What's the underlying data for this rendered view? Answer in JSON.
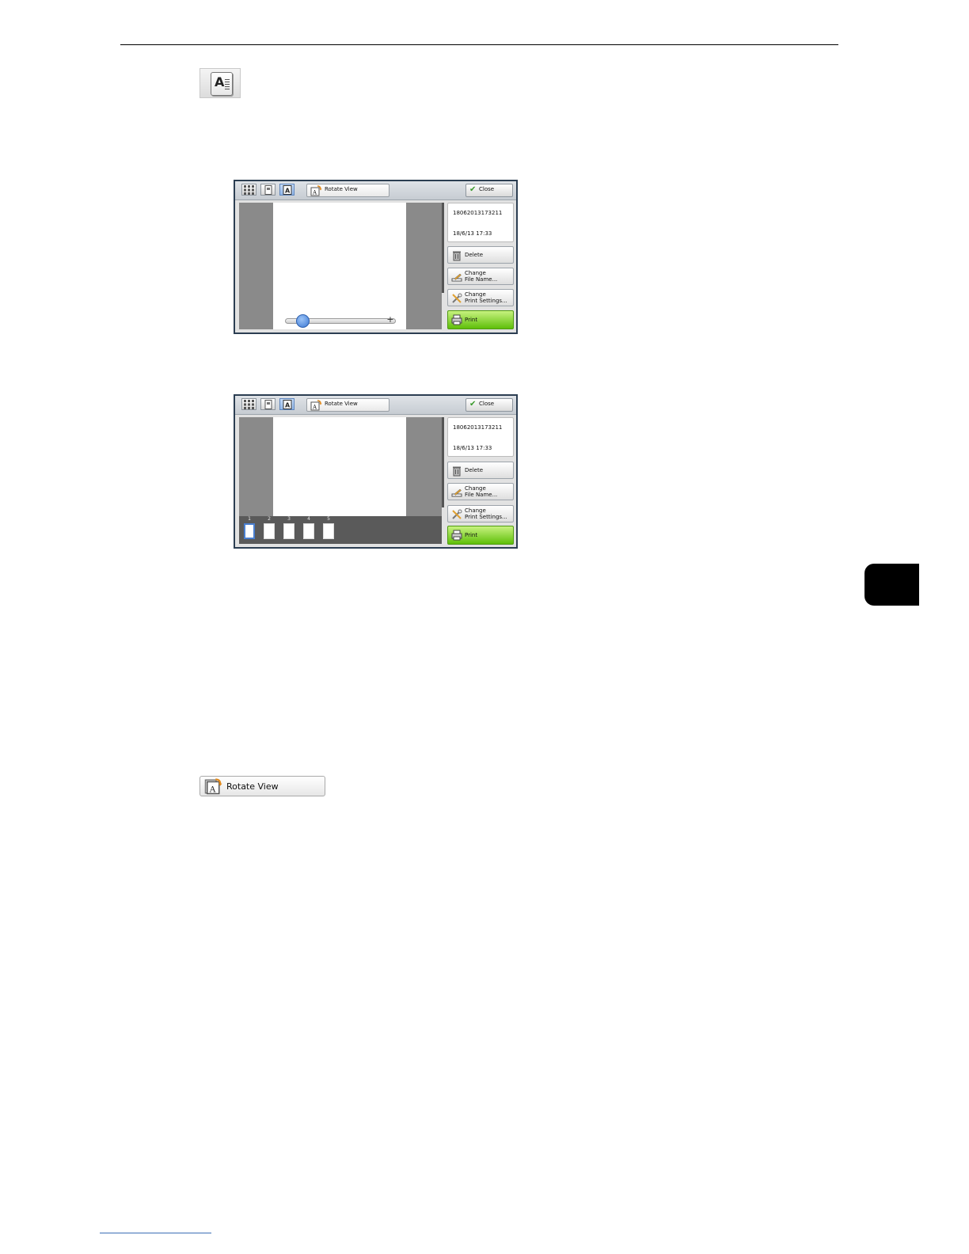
{
  "icons": {
    "single_page_icon_letter": "A",
    "rotate_icon_letter": "A"
  },
  "panel1": {
    "toolbar": {
      "rotate_label": "Rotate View",
      "close_label": "Close"
    },
    "file": {
      "id": "18062013173211",
      "datetime": "18/6/13 17:33"
    },
    "buttons": {
      "delete": "Delete",
      "change_file_name_line1": "Change",
      "change_file_name_line2": "File Name...",
      "change_print_settings_line1": "Change",
      "change_print_settings_line2": "Print Settings...",
      "print": "Print"
    },
    "zoom": {
      "minus": "−",
      "plus": "+",
      "level": 0.15
    }
  },
  "panel2": {
    "toolbar": {
      "rotate_label": "Rotate View",
      "close_label": "Close"
    },
    "file": {
      "id": "18062013173211",
      "datetime": "18/6/13 17:33"
    },
    "buttons": {
      "delete": "Delete",
      "change_file_name_line1": "Change",
      "change_file_name_line2": "File Name...",
      "change_print_settings_line1": "Change",
      "change_print_settings_line2": "Print Settings...",
      "print": "Print"
    },
    "thumbnails": [
      "1",
      "2",
      "3",
      "4",
      "5"
    ],
    "selected_thumbnail": "1"
  },
  "rotate_button": {
    "label": "Rotate View"
  },
  "colors": {
    "print_green": "#5fbf0a",
    "active_blue": "#93b8ea",
    "chapter_tab": "#000000"
  }
}
